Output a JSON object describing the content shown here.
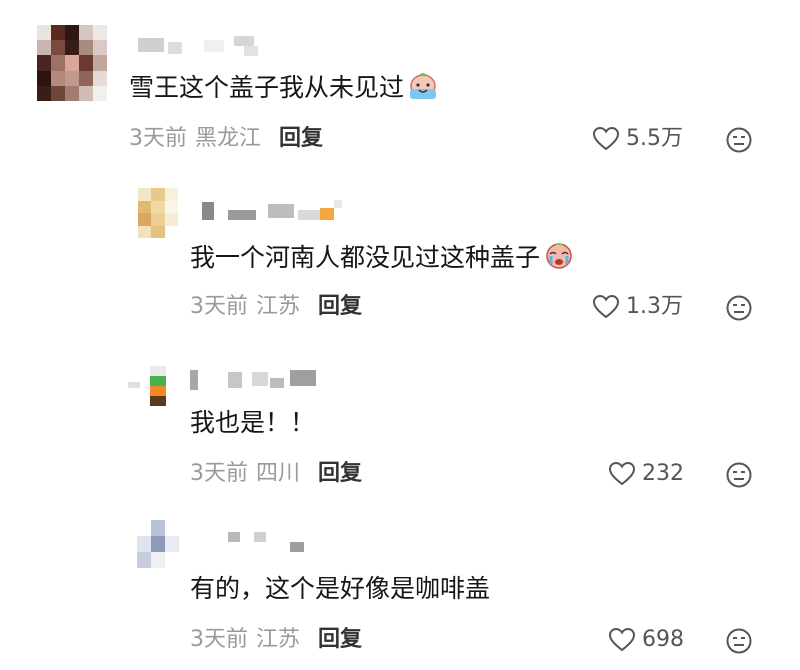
{
  "comments": [
    {
      "text": "雪王这个盖子我从未见过",
      "time": "3天前",
      "region": "黑龙江",
      "reply_label": "回复",
      "likes": "5.5万"
    },
    {
      "text": "我一个河南人都没见过这种盖子",
      "time": "3天前",
      "region": "江苏",
      "reply_label": "回复",
      "likes": "1.3万"
    },
    {
      "text": "我也是！！",
      "time": "3天前",
      "region": "四川",
      "reply_label": "回复",
      "likes": "232"
    },
    {
      "text": "有的，这个是好像是咖啡盖",
      "time": "3天前",
      "region": "江苏",
      "reply_label": "回复",
      "likes": "698"
    }
  ],
  "icons": {
    "like": "heart-outline-icon",
    "dislike": "unamused-face-icon",
    "emoji1": "crying-emoji",
    "emoji2": "crying-emoji"
  },
  "colors": {
    "text": "#161616",
    "meta": "#9a9a9a",
    "reply": "#333333",
    "icon": "#555555"
  }
}
